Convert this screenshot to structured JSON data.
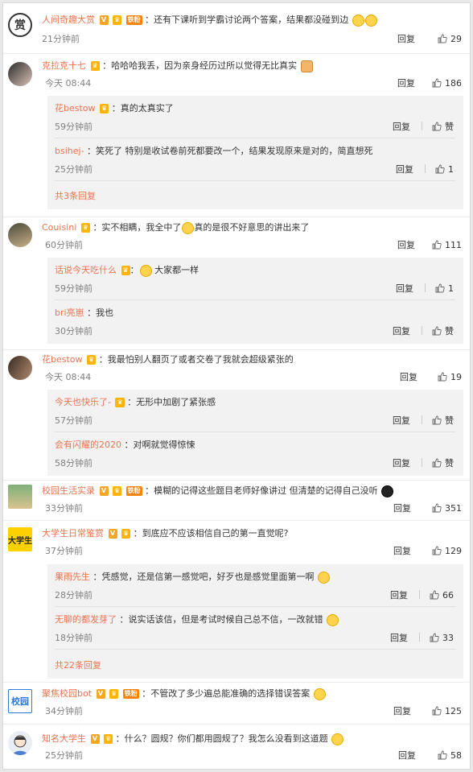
{
  "comments": [
    {
      "user": "人间奇趣大赏",
      "badges": [
        "V",
        "crown",
        "铁粉"
      ],
      "text": "：还有下课听到学霸讨论两个答案，结果都没碰到边",
      "time": "21分钟前",
      "reply": "回复",
      "likes": "29"
    },
    {
      "user": "克拉克十七",
      "badges": [
        "crown"
      ],
      "text": "：哈哈哈我丢，因为亲身经历过所以觉得无比真实",
      "time": "今天 08:44",
      "reply": "回复",
      "likes": "186",
      "replies": [
        {
          "user": "花bestow",
          "text": "：真的太真实了",
          "time": "59分钟前",
          "reply": "回复",
          "likes": "赞"
        },
        {
          "user": "bsihej-",
          "text": "：笑死了 特别是收试卷前死都要改一个，结果发现原来是对的，简直想死",
          "time": "25分钟前",
          "reply": "回复",
          "likes": "1"
        }
      ],
      "more": "共3条回复"
    },
    {
      "user": "Couisini",
      "badges": [
        "crown"
      ],
      "text": "：实不相瞒，我全中了",
      "text2": "真的是很不好意思的讲出来了",
      "time": "60分钟前",
      "reply": "回复",
      "likes": "111",
      "replies": [
        {
          "user": "话说今天吃什么",
          "text": "大家都一样",
          "time": "59分钟前",
          "reply": "回复",
          "likes": "1"
        },
        {
          "user": "bri亮崽",
          "text": "：我也",
          "time": "30分钟前",
          "reply": "回复",
          "likes": "赞"
        }
      ]
    },
    {
      "user": "花bestow",
      "badges": [
        "crown"
      ],
      "text": "：我最怕别人翻页了或者交卷了我就会超级紧张的",
      "time": "今天 08:44",
      "reply": "回复",
      "likes": "19",
      "replies": [
        {
          "user": "今天也快乐了-",
          "text": "：无形中加剧了紧张感",
          "time": "57分钟前",
          "reply": "回复",
          "likes": "赞"
        },
        {
          "user": "会有闪耀的2020",
          "text": "：对啊就觉得惊悚",
          "time": "58分钟前",
          "reply": "回复",
          "likes": "赞"
        }
      ]
    },
    {
      "user": "校园生活实录",
      "badges": [
        "V",
        "crown",
        "铁粉"
      ],
      "text": "：模糊的记得这些题目老师好像讲过 但清楚的记得自己没听",
      "time": "33分钟前",
      "reply": "回复",
      "likes": "351"
    },
    {
      "user": "大学生日常鉴赏",
      "badges": [
        "V",
        "crown"
      ],
      "text": "：到底应不应该相信自己的第一直觉呢?",
      "time": "37分钟前",
      "reply": "回复",
      "likes": "129",
      "avatar_text": "大学生",
      "replies": [
        {
          "user": "果雨先生",
          "text": "：凭感觉，还是信第一感觉吧，好歹也是感觉里面第一啊",
          "time": "28分钟前",
          "reply": "回复",
          "likes": "66"
        },
        {
          "user": "无聊的都发芽了",
          "text": "：说实话该信，但是考试时候自己总不信，一改就错",
          "time": "18分钟前",
          "reply": "回复",
          "likes": "33"
        }
      ],
      "more": "共22条回复"
    },
    {
      "user": "聚焦校园bot",
      "badges": [
        "V",
        "crown",
        "铁粉"
      ],
      "text": "：不管改了多少遍总能准确的选择错误答案",
      "time": "34分钟前",
      "reply": "回复",
      "likes": "125",
      "avatar_text": "校园"
    },
    {
      "user": "知名大学生",
      "badges": [
        "V",
        "crown"
      ],
      "text": "：什么？圆规？你们都用圆规了？我怎么没看到这道题",
      "time": "25分钟前",
      "reply": "回复",
      "likes": "58"
    }
  ],
  "colors": {
    "username": "#eb7350",
    "time": "#808080",
    "reply_bg": "#f2f2f2",
    "vip_badge": "#ff8200"
  },
  "icons": {
    "thumb": "thumbs-up-icon",
    "crown": "vip-crown-icon",
    "verified": "verified-v-icon"
  }
}
